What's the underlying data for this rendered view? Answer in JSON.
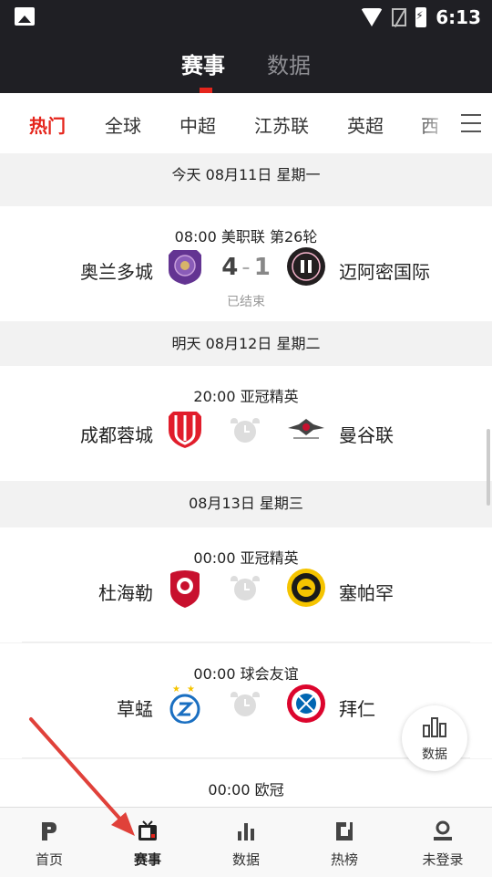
{
  "status_bar": {
    "time": "6:13"
  },
  "header": {
    "tabs": [
      {
        "label": "赛事",
        "active": true
      },
      {
        "label": "数据",
        "active": false
      }
    ]
  },
  "categories": [
    {
      "label": "热门",
      "active": true
    },
    {
      "label": "全球",
      "active": false
    },
    {
      "label": "中超",
      "active": false
    },
    {
      "label": "江苏联",
      "active": false
    },
    {
      "label": "英超",
      "active": false
    },
    {
      "label": "西",
      "active": false
    }
  ],
  "days": [
    {
      "date": "今天 08月11日 星期一",
      "matches": [
        {
          "meta": "08:00  美职联  第26轮",
          "home": "奥兰多城",
          "away": "迈阿密国际",
          "home_score": "4",
          "away_score": "1",
          "status": "已结束",
          "finished": true
        }
      ]
    },
    {
      "date": "明天 08月12日 星期二",
      "matches": [
        {
          "meta": "20:00  亚冠精英",
          "home": "成都蓉城",
          "away": "曼谷联",
          "finished": false
        }
      ]
    },
    {
      "date": "08月13日 星期三",
      "matches": [
        {
          "meta": "00:00  亚冠精英",
          "home": "杜海勒",
          "away": "塞帕罕",
          "finished": false
        },
        {
          "meta": "00:00  球会友谊",
          "home": "草蜢",
          "away": "拜仁",
          "finished": false
        },
        {
          "meta": "00:00  欧冠",
          "home": "",
          "away": "",
          "finished": false
        }
      ]
    }
  ],
  "fab": {
    "label": "数据"
  },
  "bottom_nav": [
    {
      "label": "首页",
      "icon": "home-p-icon",
      "active": false
    },
    {
      "label": "赛事",
      "icon": "tv-icon",
      "active": true
    },
    {
      "label": "数据",
      "icon": "bar-chart-icon",
      "active": false
    },
    {
      "label": "热榜",
      "icon": "rank-icon",
      "active": false
    },
    {
      "label": "未登录",
      "icon": "user-icon",
      "active": false
    }
  ],
  "colors": {
    "accent": "#e5251c",
    "header_bg": "#1f1f24",
    "annotation_arrow": "#e0413a"
  }
}
